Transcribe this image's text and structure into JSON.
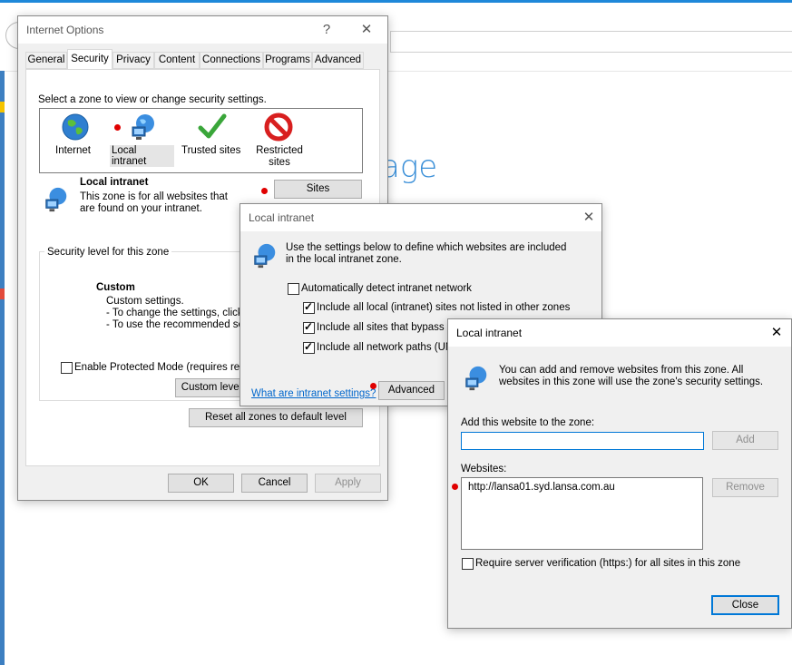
{
  "background": {
    "page_word": "age"
  },
  "internet_options": {
    "title": "Internet Options",
    "help": "?",
    "close": "✕",
    "tabs": [
      "General",
      "Security",
      "Privacy",
      "Content",
      "Connections",
      "Programs",
      "Advanced"
    ],
    "active_tab": "Security",
    "zone_prompt": "Select a zone to view or change security settings.",
    "zones": [
      {
        "label": "Internet",
        "icon": "globe-icon"
      },
      {
        "label": "Local intranet",
        "icon": "intranet-globe-icon"
      },
      {
        "label": "Trusted sites",
        "icon": "checkmark-icon"
      },
      {
        "label": "Restricted sites",
        "icon": "restricted-icon"
      }
    ],
    "selected_zone_title": "Local intranet",
    "selected_zone_desc": "This zone is for all websites that are found on your intranet.",
    "sites_button": "Sites",
    "security_group_label": "Security level for this zone",
    "custom_title": "Custom",
    "custom_line1": "Custom settings.",
    "custom_line2": "- To change the settings, click C",
    "custom_line3": "- To use the recommended sett",
    "protected_mode": "Enable Protected Mode (requires resta",
    "custom_level_button": "Custom level",
    "reset_button": "Reset all zones to default level",
    "ok": "OK",
    "cancel": "Cancel",
    "apply": "Apply"
  },
  "intranet_dialog": {
    "title": "Local intranet",
    "close": "✕",
    "description": "Use the settings below to define which websites are included in the local intranet zone.",
    "auto_detect": "Automatically detect intranet network",
    "opt1": "Include all local (intranet) sites not listed in other zones",
    "opt2": "Include all sites that bypass th",
    "opt3": "Include all network paths (UNC",
    "link": "What are intranet settings?",
    "advanced_button": "Advanced"
  },
  "sites_dialog": {
    "title": "Local intranet",
    "close": "✕",
    "description": "You can add and remove websites from this zone. All websites in this zone will use the zone's security settings.",
    "add_label": "Add this website to the zone:",
    "add_value": "",
    "add_button": "Add",
    "websites_label": "Websites:",
    "websites": [
      "http://lansa01.syd.lansa.com.au"
    ],
    "remove_button": "Remove",
    "require_https": "Require server verification (https:) for all sites in this zone",
    "close_button": "Close"
  }
}
